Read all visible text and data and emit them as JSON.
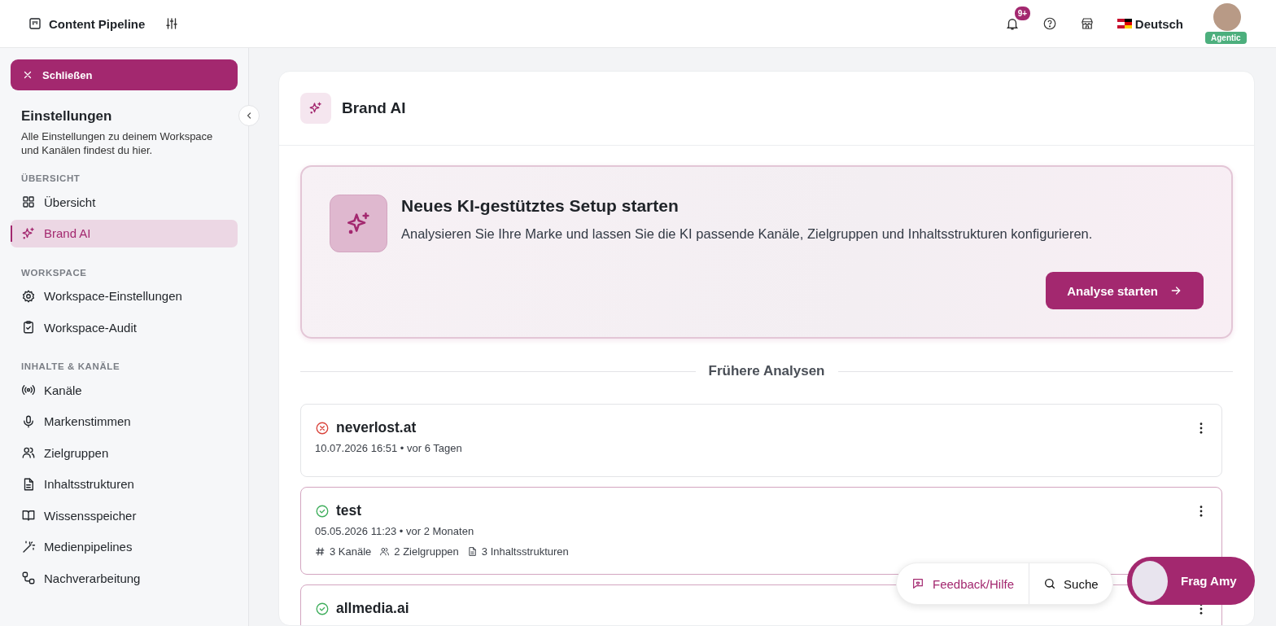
{
  "topbar": {
    "workspace": "Content Pipeline",
    "notifications_badge": "9+",
    "language": "Deutsch",
    "user_badge": "Agentic"
  },
  "sidebar": {
    "close_button": "Schließen",
    "title": "Einstellungen",
    "description": "Alle Einstellungen zu deinem Workspace und Kanälen findest du hier.",
    "sections": [
      {
        "label": "ÜBERSICHT",
        "items": [
          {
            "label": "Übersicht",
            "selected": false
          },
          {
            "label": "Brand AI",
            "selected": true
          }
        ]
      },
      {
        "label": "WORKSPACE",
        "items": [
          {
            "label": "Workspace-Einstellungen",
            "selected": false
          },
          {
            "label": "Workspace-Audit",
            "selected": false
          }
        ]
      },
      {
        "label": "INHALTE & KANÄLE",
        "items": [
          {
            "label": "Kanäle",
            "selected": false
          },
          {
            "label": "Markenstimmen",
            "selected": false
          },
          {
            "label": "Zielgruppen",
            "selected": false
          },
          {
            "label": "Inhaltsstrukturen",
            "selected": false
          },
          {
            "label": "Wissensspeicher",
            "selected": false
          },
          {
            "label": "Medienpipelines",
            "selected": false
          },
          {
            "label": "Nachverarbeitung",
            "selected": false
          }
        ]
      }
    ]
  },
  "page": {
    "title": "Brand AI",
    "setup_banner": {
      "title": "Neues KI-gestütztes Setup starten",
      "description": "Analysieren Sie Ihre Marke und lassen Sie die KI passende Kanäle, Zielgruppen und Inhaltsstrukturen konfigurieren.",
      "button": "Analyse starten"
    },
    "history_heading": "Frühere Analysen",
    "analyses": [
      {
        "title": "neverlost.at",
        "meta": "10.07.2026 16:51 • vor 6 Tagen",
        "success": false
      },
      {
        "title": "test",
        "meta": "05.05.2026 11:23 • vor 2 Monaten",
        "success": true,
        "stats": [
          {
            "kind": "channels",
            "label": "3 Kanäle"
          },
          {
            "kind": "audiences",
            "label": "2 Zielgruppen"
          },
          {
            "kind": "structures",
            "label": "3 Inhaltsstrukturen"
          }
        ]
      },
      {
        "title": "allmedia.ai",
        "success": true
      }
    ]
  },
  "floating": {
    "feedback": "Feedback/Hilfe",
    "search": "Suche",
    "assistant": "Frag Amy"
  }
}
